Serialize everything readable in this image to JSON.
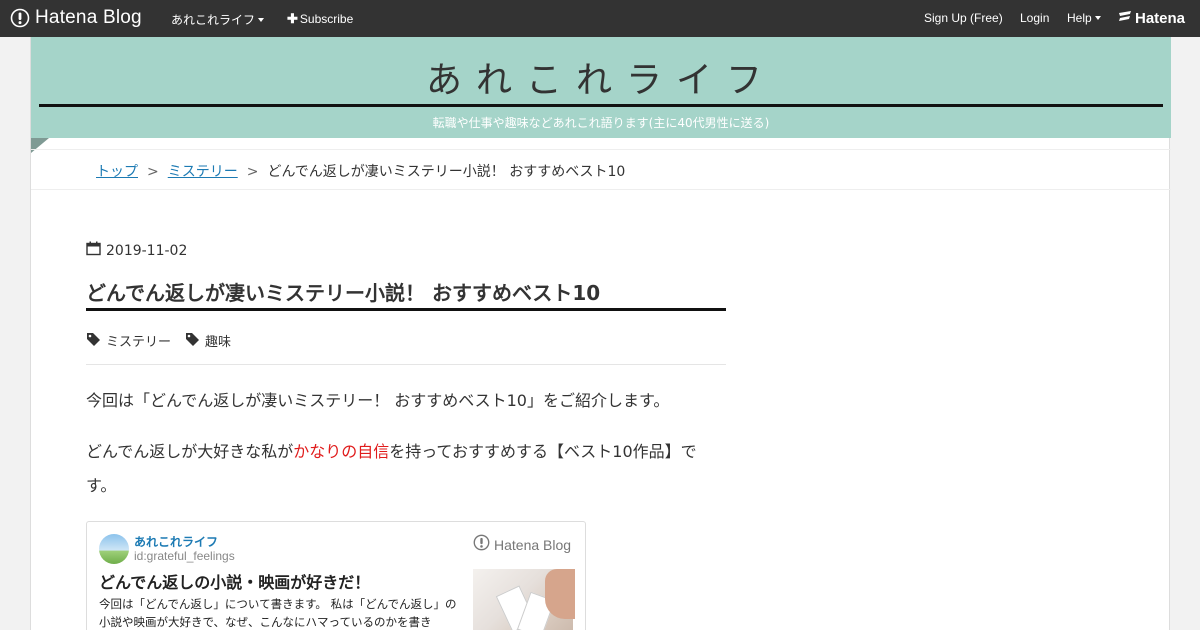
{
  "global_header": {
    "logo_text": "Hatena Blog",
    "blog_menu_label": "あれこれライフ",
    "subscribe_label": "Subscribe",
    "signup_label": "Sign Up (Free)",
    "login_label": "Login",
    "help_label": "Help",
    "hatena_label": "Hatena"
  },
  "blog": {
    "title": "あれこれライフ",
    "description": "転職や仕事や趣味などあれこれ語ります(主に40代男性に送る)",
    "accent_color": "#a5d4c9"
  },
  "breadcrumb": {
    "items": [
      {
        "label": "トップ",
        "link": true
      },
      {
        "label": "ミステリー",
        "link": true
      },
      {
        "label": "どんでん返しが凄いミステリー小説！ おすすめベスト10",
        "link": false
      }
    ],
    "separator": ">"
  },
  "entry": {
    "date": "2019-11-02",
    "title": "どんでん返しが凄いミステリー小説！ おすすめベスト10",
    "categories": [
      "ミステリー",
      "趣味"
    ],
    "paragraph1": "今回は「どんでん返しが凄いミステリー！ おすすめベスト10」をご紹介します。",
    "paragraph2": {
      "before": "どんでん返しが大好きな私が",
      "highlight": "かなりの自信",
      "after": "を持っておすすめする【ベスト10作品】です。",
      "highlight_color": "#e01b1b"
    }
  },
  "embed_card": {
    "blog_name": "あれこれライフ",
    "user_id": "id:grateful_feelings",
    "logo_text": "Hatena Blog",
    "title": "どんでん返しの小説・映画が好きだ！",
    "excerpt": "今回は「どんでん返し」について書きます。 私は「どんでん返し」の小説や映画が大好きで、なぜ、こんなにハマっているのかを書き"
  },
  "icons": [
    "hatena-blog-logo-icon",
    "caret-down-icon",
    "plus-icon",
    "hatena-logo-icon",
    "calendar-icon",
    "tag-icon"
  ]
}
